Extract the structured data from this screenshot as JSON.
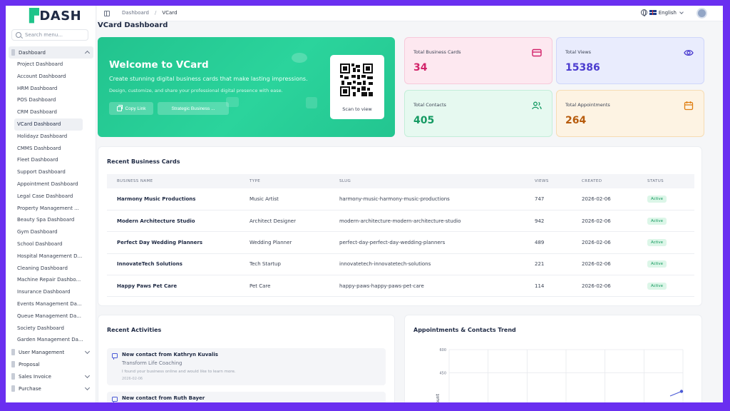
{
  "sidebar": {
    "logo": "DASH",
    "search_placeholder": "Search menu...",
    "dashboard_group": "Dashboard",
    "dashboard_items": [
      "Project Dashboard",
      "Account Dashboard",
      "HRM Dashboard",
      "POS Dashboard",
      "CRM Dashboard",
      "VCard Dashboard",
      "Holidayz Dashboard",
      "CMMS Dashboard",
      "Fleet Dashboard",
      "Support Dashboard",
      "Appointment Dashboard",
      "Legal Case Dashboard",
      "Property Management ...",
      "Beauty Spa Dashboard",
      "Gym Dashboard",
      "School Dashboard",
      "Hospital Management D...",
      "Cleaning Dashboard",
      "Machine Repair Dashbo...",
      "Insurance Dashboard",
      "Events Management Da...",
      "Queue Management Da...",
      "Society Dashboard",
      "Garden Management Da..."
    ],
    "current_item_index": 5,
    "groups_after": [
      {
        "label": "User Management",
        "has_children": true
      },
      {
        "label": "Proposal",
        "has_children": false
      },
      {
        "label": "Sales Invoice",
        "has_children": true
      },
      {
        "label": "Purchase",
        "has_children": true
      }
    ]
  },
  "topbar": {
    "breadcrumbs": [
      "Dashboard",
      "VCard"
    ],
    "language": "English",
    "icons": [
      "panel-toggle-icon",
      "globe-icon",
      "flag-icon",
      "avatar"
    ]
  },
  "page": {
    "title": "VCard Dashboard"
  },
  "welcome": {
    "title": "Welcome to VCard",
    "subtitle": "Create stunning digital business cards that make lasting impressions.",
    "description": "Design, customize, and share your professional digital presence with ease.",
    "copy_button": "Copy Link",
    "select_button": "Strategic Business ...",
    "qr_label": "Scan to view"
  },
  "stats": [
    {
      "label": "Total Business Cards",
      "value": "34",
      "icon": "card-icon",
      "color": "#d2236a"
    },
    {
      "label": "Total Views",
      "value": "15386",
      "icon": "eye-icon",
      "color": "#4b3ccf"
    },
    {
      "label": "Total Contacts",
      "value": "405",
      "icon": "users-icon",
      "color": "#149a62"
    },
    {
      "label": "Total Appointments",
      "value": "264",
      "icon": "calendar-icon",
      "color": "#b75b0c"
    }
  ],
  "recent_cards": {
    "title": "Recent Business Cards",
    "columns": [
      "BUSINESS NAME",
      "TYPE",
      "SLUG",
      "VIEWS",
      "CREATED",
      "STATUS"
    ],
    "rows": [
      [
        "Harmony Music Productions",
        "Music Artist",
        "harmony-music-harmony-music-productions",
        "747",
        "2026-02-06",
        "Active"
      ],
      [
        "Modern Architecture Studio",
        "Architect Designer",
        "modern-architecture-modern-architecture-studio",
        "942",
        "2026-02-06",
        "Active"
      ],
      [
        "Perfect Day Wedding Planners",
        "Wedding Planner",
        "perfect-day-perfect-day-wedding-planners",
        "489",
        "2026-02-06",
        "Active"
      ],
      [
        "InnovateTech Solutions",
        "Tech Startup",
        "innovatetech-innovatetech-solutions",
        "221",
        "2026-02-06",
        "Active"
      ],
      [
        "Happy Paws Pet Care",
        "Pet Care",
        "happy-paws-happy-paws-pet-care",
        "114",
        "2026-02-06",
        "Active"
      ]
    ]
  },
  "activities": {
    "title": "Recent Activities",
    "items": [
      {
        "title": "New contact from Kathryn Kuvalis",
        "subtitle": "Transform Life Coaching",
        "desc": "I found your business online and would like to learn more.",
        "date": "2026-02-06"
      },
      {
        "title": "New contact from Ruth Bayer",
        "subtitle": "",
        "desc": "",
        "date": ""
      }
    ]
  },
  "trend": {
    "title": "Appointments & Contacts Trend"
  },
  "chart_data": {
    "type": "line",
    "title": "Appointments & Contacts Trend",
    "ylabel": "Count",
    "y_ticks": [
      "600",
      "450"
    ],
    "ylim": [
      0,
      600
    ],
    "grid": true,
    "series": [
      {
        "values": [
          300,
          330
        ]
      }
    ]
  },
  "colors": {
    "accent": "#22c38e",
    "border": "#6a2ff0",
    "badge_bg": "#dcf6e8",
    "badge_text": "#159a5f"
  }
}
